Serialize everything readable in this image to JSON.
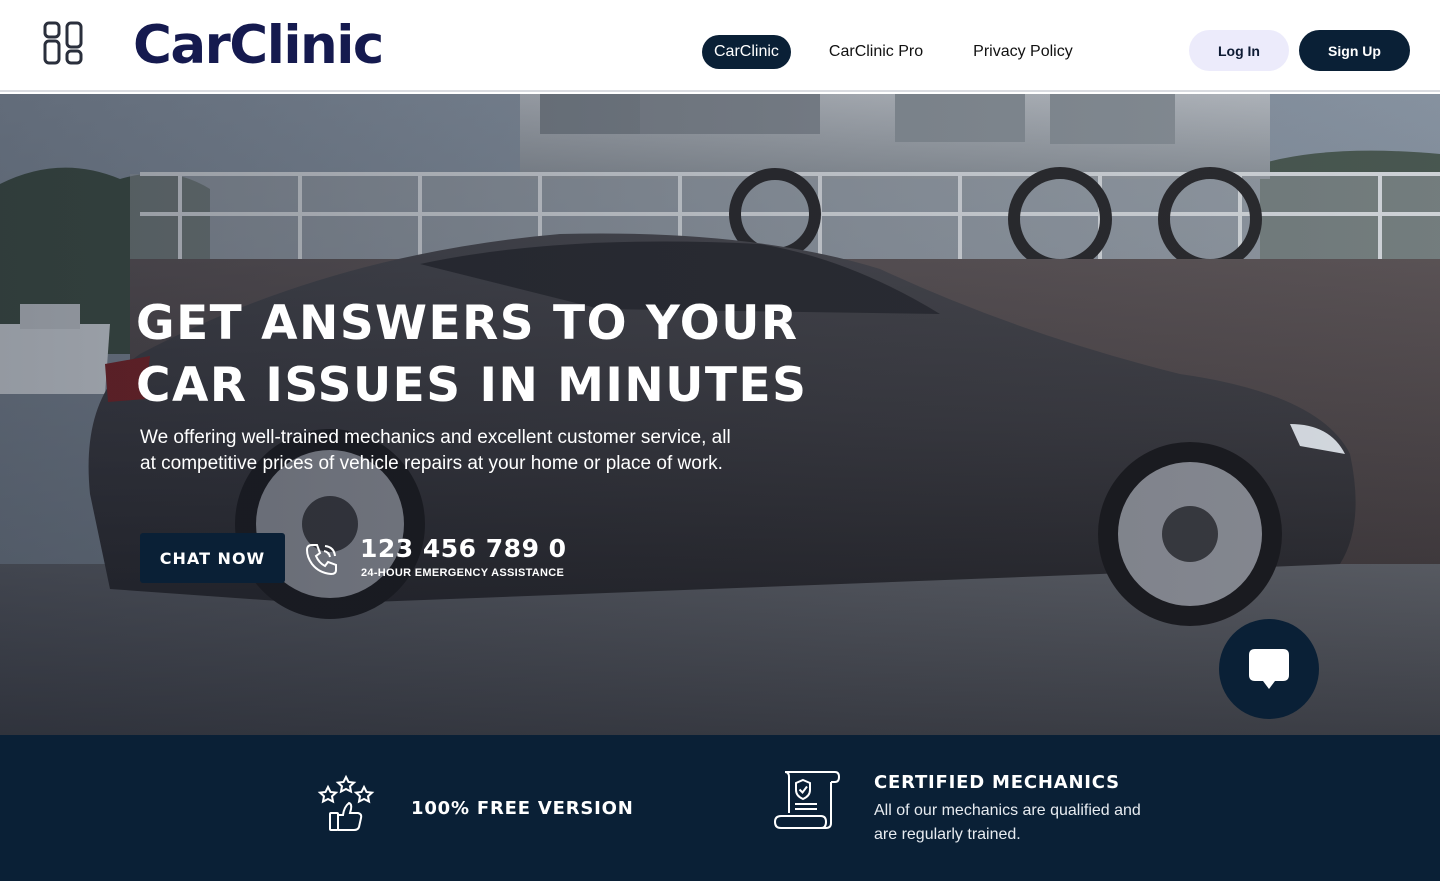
{
  "header": {
    "brand": "CarClinic",
    "nav": [
      {
        "label": "CarClinic",
        "active": true
      },
      {
        "label": "CarClinic Pro",
        "active": false
      },
      {
        "label": "Privacy Policy",
        "active": false
      }
    ],
    "login_label": "Log In",
    "signup_label": "Sign Up"
  },
  "hero": {
    "title_line1": "GET ANSWERS TO YOUR",
    "title_line2": "CAR ISSUES IN MINUTES",
    "subtitle": "We offering well-trained mechanics and excellent customer service, all at competitive prices of vehicle repairs at your home or place of work.",
    "cta_label": "CHAT NOW",
    "phone_number": "123 456 789 0",
    "phone_caption": "24-HOUR EMERGENCY ASSISTANCE"
  },
  "features": [
    {
      "icon": "thumbs-up-stars-icon",
      "title": "100% FREE VERSION",
      "description": ""
    },
    {
      "icon": "certificate-shield-icon",
      "title": "CERTIFIED MECHANICS",
      "description": "All of our mechanics are qualified and are regularly trained."
    }
  ],
  "colors": {
    "navy": "#0a2036",
    "brand_text": "#151a4f",
    "login_bg": "#ecebfb"
  }
}
